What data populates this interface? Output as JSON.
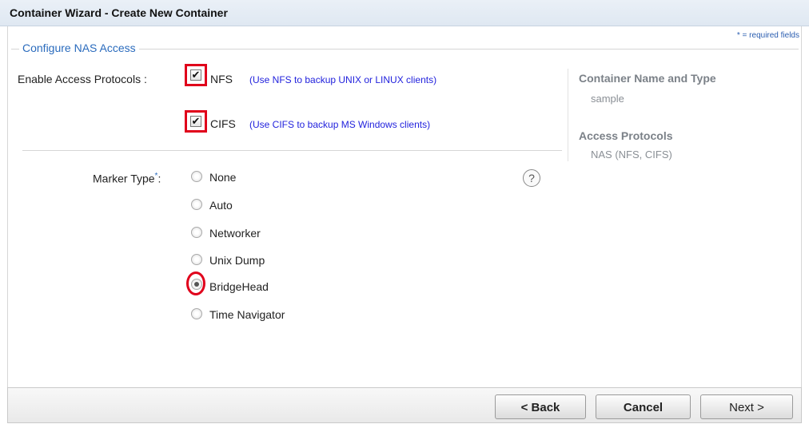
{
  "window": {
    "title": "Container Wizard - Create New Container"
  },
  "form": {
    "required_note": "* = required fields",
    "section_legend": "Configure NAS Access",
    "access_protocols_label": "Enable Access Protocols :",
    "protocols": [
      {
        "label": "NFS",
        "hint": "(Use NFS to backup UNIX or LINUX clients)",
        "checked": true
      },
      {
        "label": "CIFS",
        "hint": "(Use CIFS to backup MS Windows clients)",
        "checked": true
      }
    ],
    "marker_type_label": "Marker Type",
    "marker_required_star": "*",
    "marker_colon": ":",
    "marker_options": [
      "None",
      "Auto",
      "Networker",
      "Unix Dump",
      "BridgeHead",
      "Time Navigator"
    ],
    "marker_selected": "BridgeHead",
    "help_glyph": "?"
  },
  "summary": {
    "container_heading": "Container Name and Type",
    "container_value": "sample",
    "protocols_heading": "Access Protocols",
    "protocols_value": "NAS (NFS, CIFS)"
  },
  "footer": {
    "back_label": "< Back",
    "cancel_label": "Cancel",
    "next_label": "Next >"
  },
  "colors": {
    "highlight": "#e0001b",
    "hint_text": "#2222dd",
    "legend_text": "#2a6bbd"
  }
}
